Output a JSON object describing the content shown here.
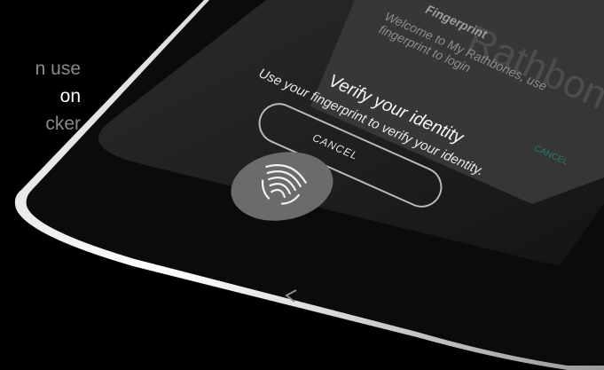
{
  "side_text": {
    "line1": "n use",
    "line2": "on",
    "line3": "cker"
  },
  "screen": {
    "background_title": "Fingerprint",
    "background_message": "Welcome to My Rathbones, use fingerprint to login",
    "background_cancel": "CANCEL",
    "watermark": "Rathbone",
    "dialog_title": "Verify your identity",
    "dialog_subtitle": "Use your fingerprint to verify your identity.",
    "cancel_label": "CANCEL"
  },
  "icons": {
    "fingerprint": "fingerprint-icon",
    "back": "back-chevron-icon"
  }
}
